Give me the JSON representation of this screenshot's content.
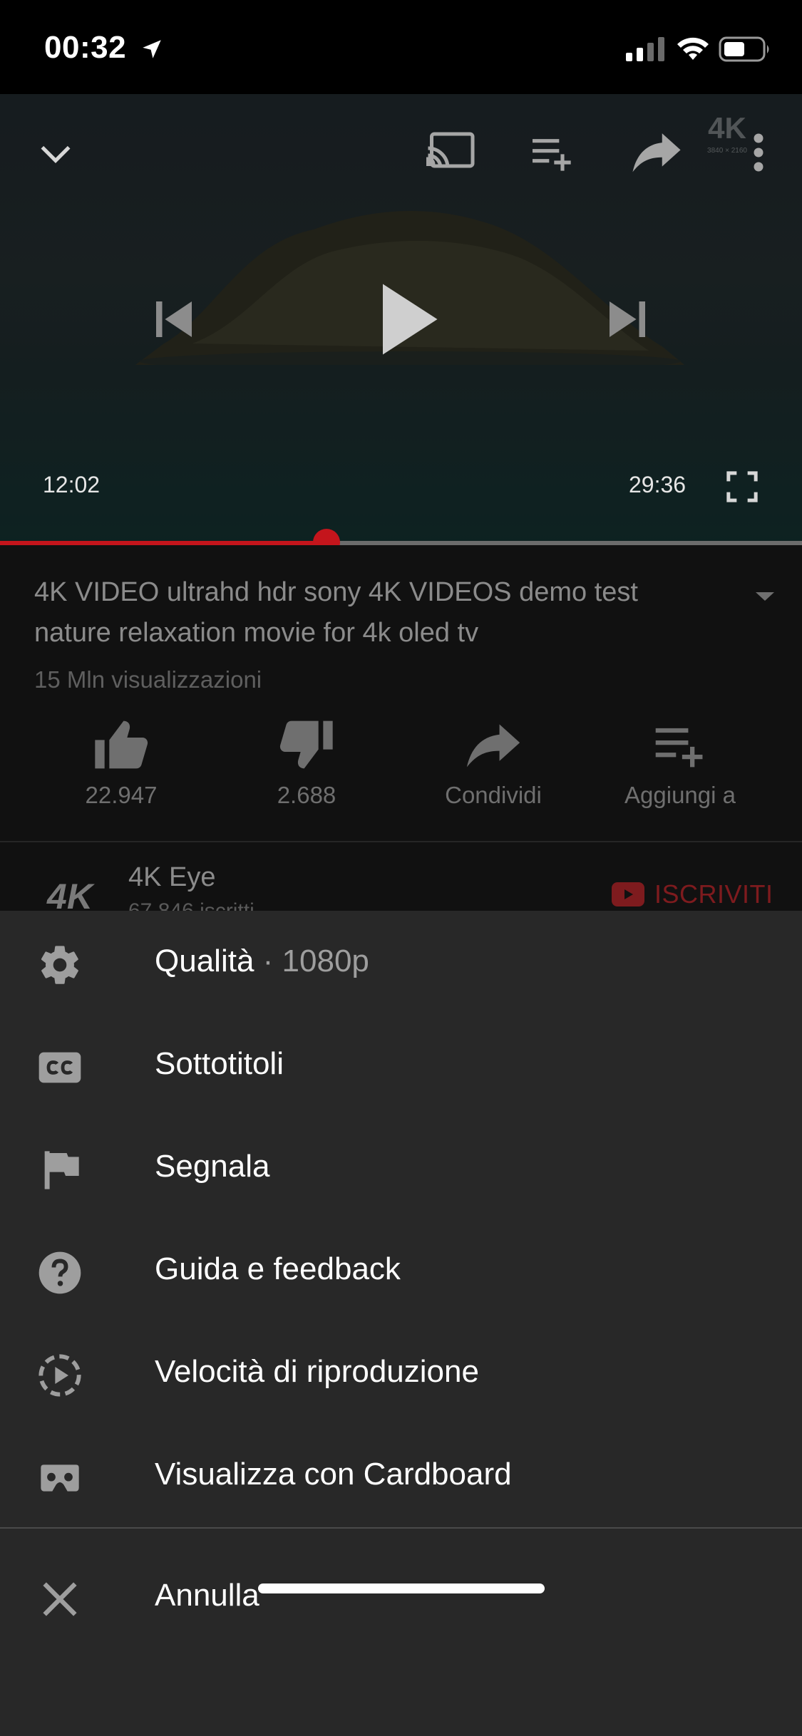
{
  "status_bar": {
    "time": "00:32",
    "icons": [
      "location-arrow-icon",
      "signal-icon",
      "wifi-icon",
      "battery-icon"
    ]
  },
  "player": {
    "current_time": "12:02",
    "duration": "29:36",
    "progress_fraction": 0.407,
    "accent_color": "#c4151c",
    "controls": [
      "collapse-chevron-icon",
      "cast-icon",
      "add-to-queue-icon",
      "share-icon",
      "more-vert-icon",
      "previous-icon",
      "play-icon",
      "next-icon",
      "fullscreen-icon"
    ]
  },
  "video": {
    "title": "4K VIDEO ultrahd hdr sony 4K VIDEOS demo test nature relaxation movie for 4k oled tv",
    "views": "15 Mln visualizzazioni",
    "actions": [
      {
        "icon": "thumb-up-icon",
        "label": "22.947"
      },
      {
        "icon": "thumb-down-icon",
        "label": "2.688"
      },
      {
        "icon": "share-icon",
        "label": "Condividi"
      },
      {
        "icon": "playlist-add-icon",
        "label": "Aggiungi a"
      }
    ]
  },
  "channel": {
    "name": "4K Eye",
    "subscribers": "67.846 iscritti",
    "subscribe_label": "ISCRIVITI"
  },
  "menu": {
    "items": [
      {
        "icon": "gear-icon",
        "label": "Qualità",
        "value": "1080p"
      },
      {
        "icon": "closed-captions-icon",
        "label": "Sottotitoli"
      },
      {
        "icon": "flag-icon",
        "label": "Segnala"
      },
      {
        "icon": "help-icon",
        "label": "Guida e feedback"
      },
      {
        "icon": "playback-speed-icon",
        "label": "Velocità di riproduzione"
      },
      {
        "icon": "cardboard-vr-icon",
        "label": "Visualizza con Cardboard"
      }
    ],
    "cancel": {
      "icon": "close-icon",
      "label": "Annulla"
    }
  }
}
